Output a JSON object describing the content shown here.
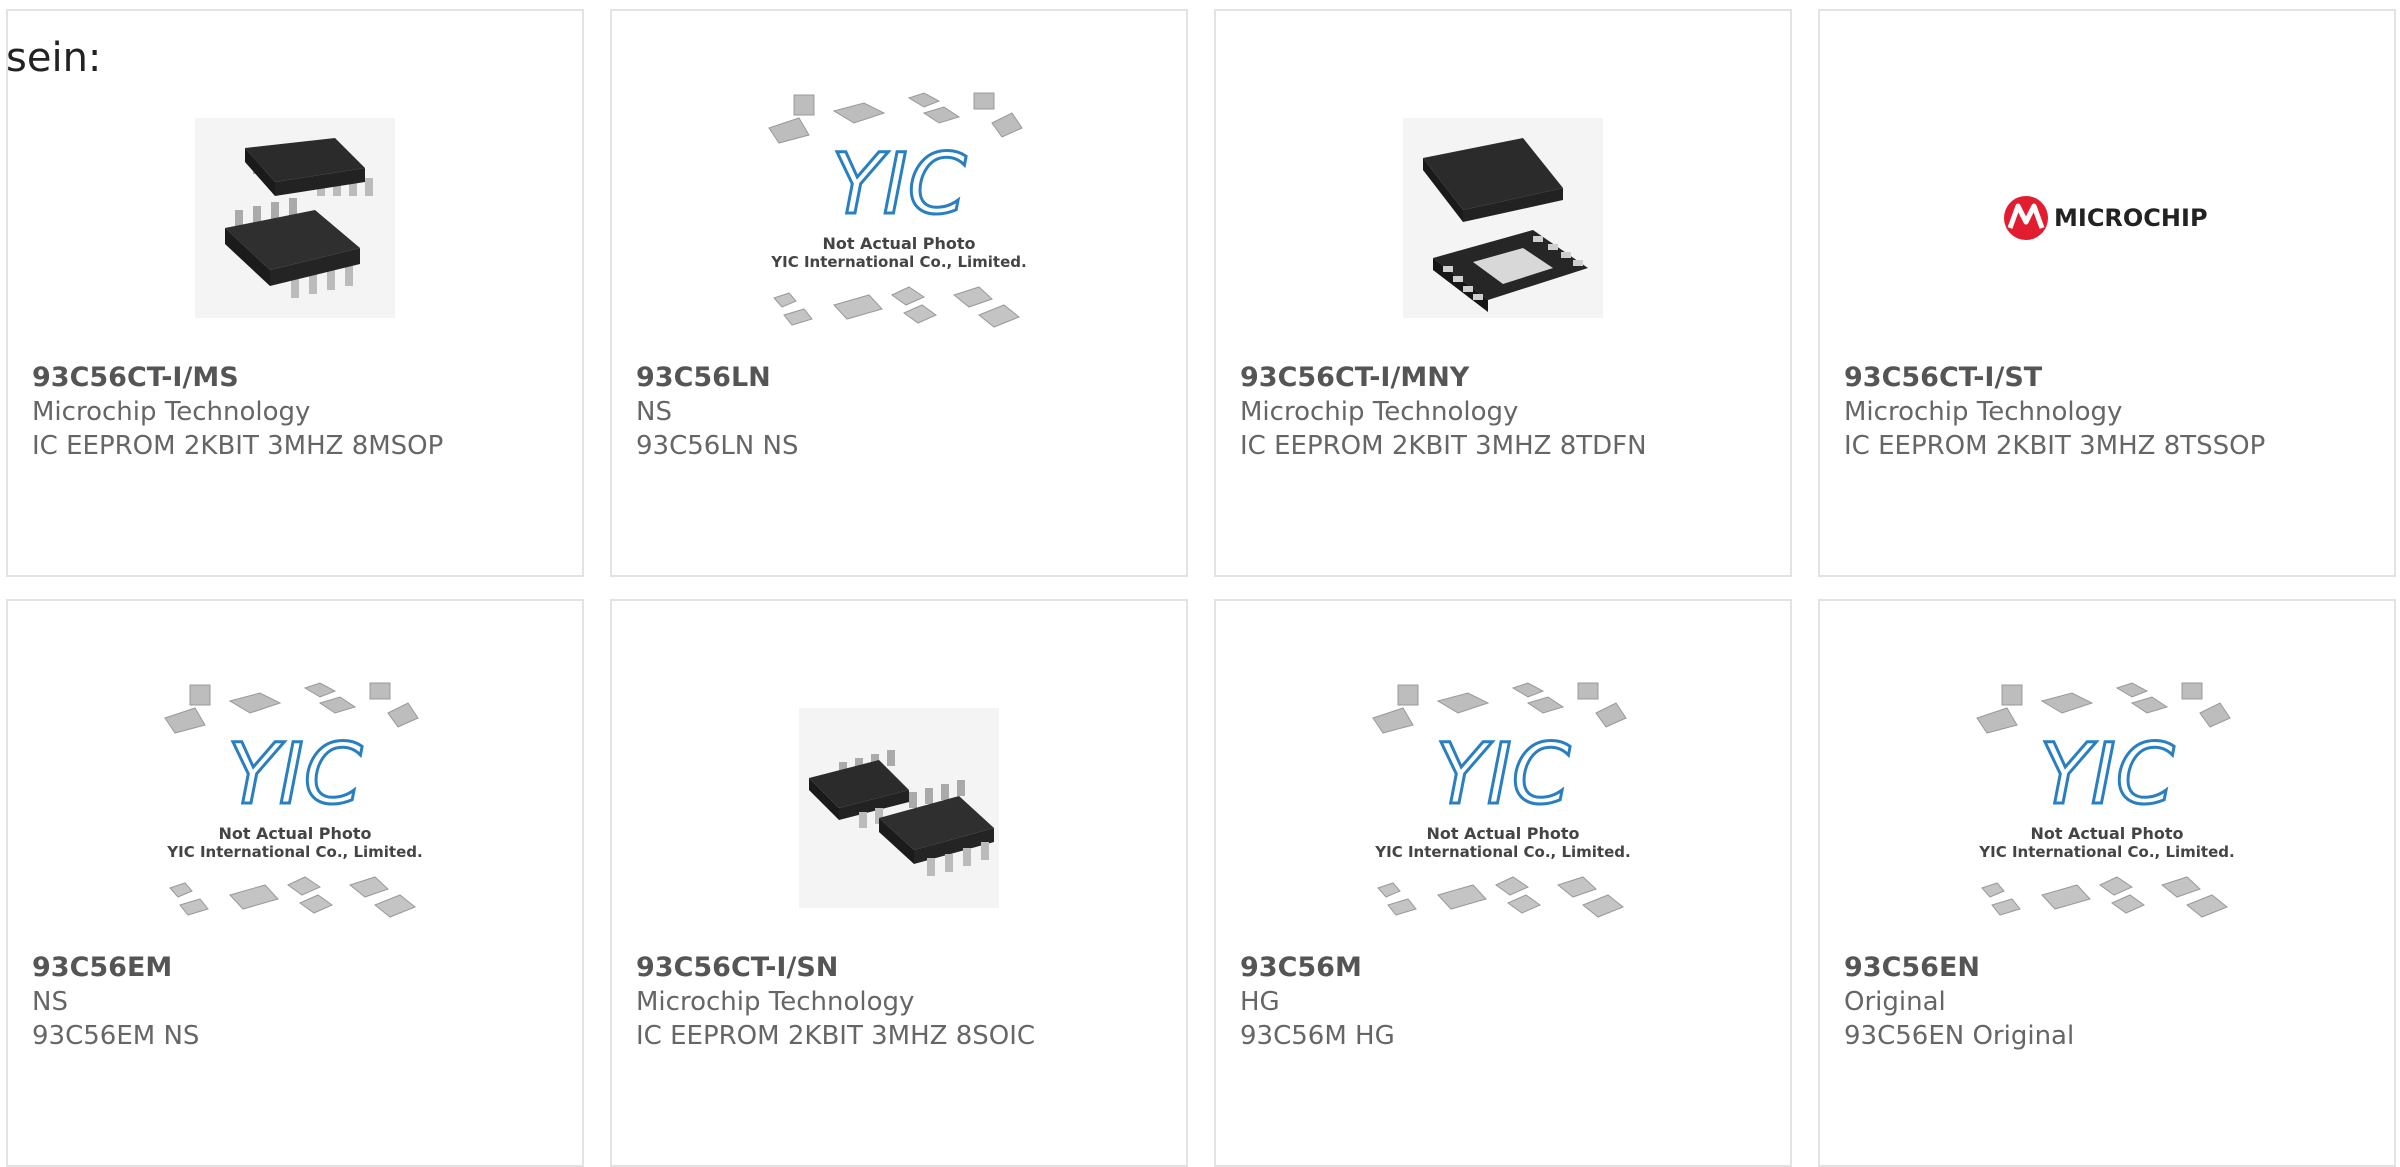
{
  "page": {
    "intro_text": "sein:"
  },
  "colors": {
    "accent": "#e5391c",
    "bar": "#3a3a3a",
    "border": "#e3e3e3"
  },
  "products": [
    {
      "part": "93C56CT-I/MS",
      "manufacturer": "Microchip Technology",
      "description": "IC EEPROM 2KBIT 3MHZ 8MSOP",
      "image": "msop8-chip-photo"
    },
    {
      "part": "93C56LN",
      "manufacturer": "NS",
      "description": "93C56LN NS",
      "image": "yic-placeholder",
      "placeholder_line1": "Not Actual Photo",
      "placeholder_line2": "YIC International Co., Limited.",
      "placeholder_logo": "YIC"
    },
    {
      "part": "93C56CT-I/MNY",
      "manufacturer": "Microchip Technology",
      "description": "IC EEPROM 2KBIT 3MHZ 8TDFN",
      "image": "tdfn8-chip-photo"
    },
    {
      "part": "93C56CT-I/ST",
      "manufacturer": "Microchip Technology",
      "description": "IC EEPROM 2KBIT 3MHZ 8TSSOP",
      "image": "microchip-logo",
      "logo_text": "MICROCHIP"
    },
    {
      "part": "93C56EM",
      "manufacturer": "NS",
      "description": "93C56EM NS",
      "image": "yic-placeholder",
      "placeholder_line1": "Not Actual Photo",
      "placeholder_line2": "YIC International Co., Limited.",
      "placeholder_logo": "YIC"
    },
    {
      "part": "93C56CT-I/SN",
      "manufacturer": "Microchip Technology",
      "description": "IC EEPROM 2KBIT 3MHZ 8SOIC",
      "image": "soic8-chip-photo"
    },
    {
      "part": "93C56M",
      "manufacturer": "HG",
      "description": "93C56M HG",
      "image": "yic-placeholder",
      "placeholder_line1": "Not Actual Photo",
      "placeholder_line2": "YIC International Co., Limited.",
      "placeholder_logo": "YIC"
    },
    {
      "part": "93C56EN",
      "manufacturer": "Original",
      "description": "93C56EN Original",
      "image": "yic-placeholder",
      "placeholder_line1": "Not Actual Photo",
      "placeholder_line2": "YIC International Co., Limited.",
      "placeholder_logo": "YIC"
    }
  ]
}
